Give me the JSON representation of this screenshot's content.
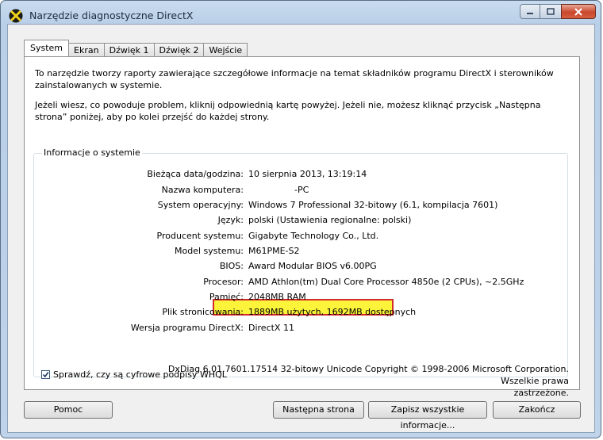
{
  "window": {
    "title": "Narzędzie diagnostyczne DirectX"
  },
  "tabs": [
    {
      "label": "System",
      "active": true
    },
    {
      "label": "Ekran"
    },
    {
      "label": "Dźwięk 1"
    },
    {
      "label": "Dźwięk 2"
    },
    {
      "label": "Wejście"
    }
  ],
  "intro": {
    "line1": "To narzędzie tworzy raporty zawierające szczegółowe informacje na temat składników programu DirectX i sterowników zainstalowanych w systemie.",
    "line2": "Jeżeli wiesz, co powoduje problem, kliknij odpowiednią kartę powyżej. Jeżeli nie, możesz kliknąć przycisk „Następna strona” poniżej, aby po kolei przejść do każdej strony."
  },
  "sysinfo": {
    "group_title": "Informacje o systemie",
    "rows": [
      {
        "label": "Bieżąca data/godzina:",
        "value": "10 sierpnia 2013, 13:19:14"
      },
      {
        "label": "Nazwa komputera:",
        "value": "-PC"
      },
      {
        "label": "System operacyjny:",
        "value": "Windows 7 Professional 32-bitowy (6.1, kompilacja 7601)"
      },
      {
        "label": "Język:",
        "value": "polski (Ustawienia regionalne: polski)"
      },
      {
        "label": "Producent systemu:",
        "value": "Gigabyte Technology Co., Ltd."
      },
      {
        "label": "Model systemu:",
        "value": "M61PME-S2"
      },
      {
        "label": "BIOS:",
        "value": "Award Modular BIOS v6.00PG"
      },
      {
        "label": "Procesor:",
        "value": "AMD Athlon(tm) Dual Core Processor 4850e (2 CPUs), ~2.5GHz"
      },
      {
        "label": "Pamięć:",
        "value": "2048MB RAM"
      },
      {
        "label": "Plik stronicowania:",
        "value": "1889MB użytych, 1692MB dostępnych"
      },
      {
        "label": "Wersja programu DirectX:",
        "value": "DirectX 11"
      }
    ],
    "whql_label": "Sprawdź, czy są cyfrowe podpisy WHQL",
    "whql_checked": true
  },
  "footer": {
    "line1": "DxDiag 6.01.7601.17514 32-bitowy Unicode  Copyright © 1998-2006 Microsoft Corporation. Wszelkie prawa",
    "line2": "zastrzeżone."
  },
  "buttons": {
    "help": "Pomoc",
    "next": "Następna strona",
    "save": "Zapisz wszystkie informacje...",
    "exit": "Zakończ"
  },
  "colors": {
    "highlight": "#fbf43a",
    "highlight_border": "#d42a2a"
  }
}
